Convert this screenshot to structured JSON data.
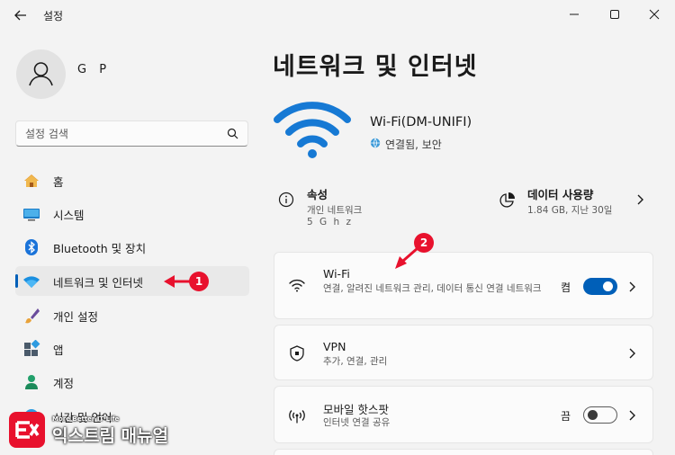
{
  "window": {
    "title": "설정"
  },
  "profile": {
    "name": "G P"
  },
  "search": {
    "placeholder": "설정 검색"
  },
  "sidebar": {
    "items": [
      {
        "label": "홈",
        "icon": "home-icon"
      },
      {
        "label": "시스템",
        "icon": "system-icon"
      },
      {
        "label": "Bluetooth 및 장치",
        "icon": "bluetooth-icon"
      },
      {
        "label": "네트워크 및 인터넷",
        "icon": "network-icon",
        "active": true
      },
      {
        "label": "개인 설정",
        "icon": "brush-icon"
      },
      {
        "label": "앱",
        "icon": "apps-icon"
      },
      {
        "label": "계정",
        "icon": "account-icon"
      },
      {
        "label": "시간 및 언어",
        "icon": "time-language-icon"
      }
    ]
  },
  "main": {
    "title": "네트워크 및 인터넷",
    "connection": {
      "name": "Wi-Fi(DM-UNIFI)",
      "status": "연결됨, 보안"
    },
    "properties": {
      "title": "속성",
      "line1": "개인 네트워크",
      "line2": "5 G h z"
    },
    "data_usage": {
      "title": "데이터 사용량",
      "detail": "1.84 GB, 지난 30일"
    },
    "cards": [
      {
        "title": "Wi-Fi",
        "subtitle": "연결, 알려진 네트워크 관리, 데이터 통신 연결 네트워크",
        "toggle_label": "켬",
        "toggle_on": true
      },
      {
        "title": "VPN",
        "subtitle": "추가, 연결, 관리"
      },
      {
        "title": "모바일 핫스팟",
        "subtitle": "인터넷 연결 공유",
        "toggle_label": "끔",
        "toggle_on": false
      }
    ]
  },
  "annotations": {
    "marker1": "1",
    "marker2": "2"
  },
  "watermark": {
    "small": "More Better IT Life",
    "big": "익스트림 매뉴얼"
  },
  "colors": {
    "accent": "#005fb8",
    "annotation": "#e8112d",
    "wifi_hero": "#1679d4"
  }
}
